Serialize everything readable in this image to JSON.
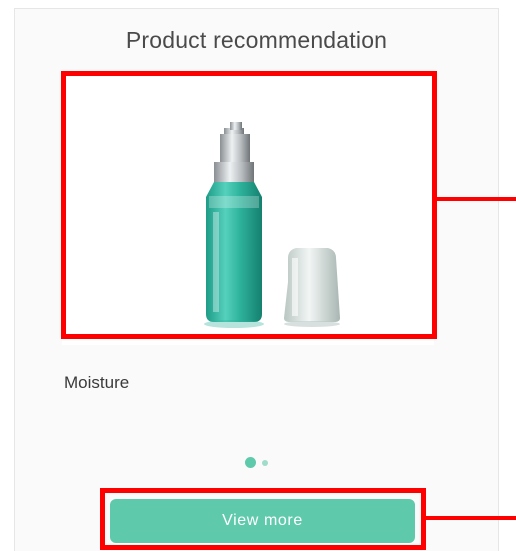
{
  "card": {
    "title": "Product recommendation",
    "product_name": "Moisture",
    "view_more_label": "View more",
    "carousel": {
      "pages": 2,
      "active_index": 0
    }
  },
  "colors": {
    "accent": "#5fcaab",
    "annotation": "#ff0000",
    "bottle": "#2fb39d"
  },
  "icons": {
    "product_image": "serum-bottle-image"
  }
}
